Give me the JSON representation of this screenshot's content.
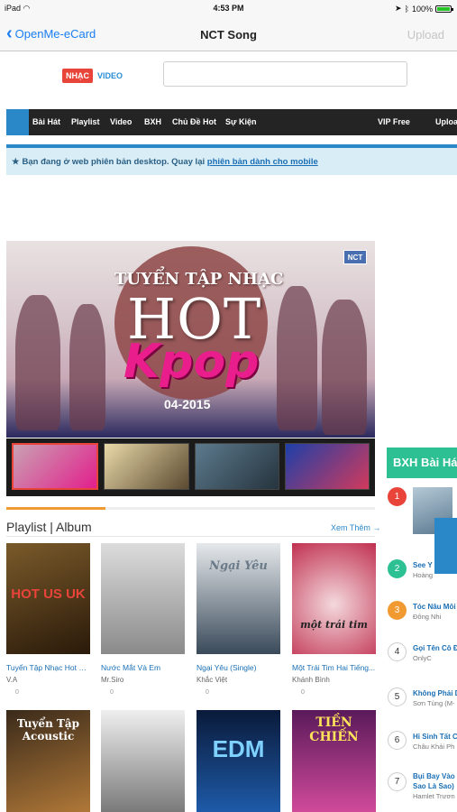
{
  "status": {
    "device": "iPad",
    "time": "4:53 PM",
    "battery": "100%"
  },
  "nav": {
    "back": "OpenMe-eCard",
    "title": "NCT Song",
    "upload": "Upload"
  },
  "header": {
    "mode_music": "NHẠC",
    "mode_video": "VIDEO",
    "search_placeholder": ""
  },
  "menu": [
    "Bài Hát",
    "Playlist",
    "Video",
    "BXH",
    "Chủ Đề Hot",
    "Sự Kiện",
    "VIP Free",
    "Uploa"
  ],
  "notice": {
    "text": "Bạn đang ở web phiên bản desktop. Quay lại ",
    "link": "phiên bản dành cho mobile"
  },
  "banner": {
    "line1": "TUYỂN TẬP NHẠC",
    "line2": "HOT",
    "line3": "Kpop",
    "line4": "04-2015",
    "logo": "NCT"
  },
  "playlist": {
    "heading": "Playlist | Album",
    "more": "Xem Thêm →",
    "items": [
      {
        "title": "Tuyển Tập Nhạc Hot U...",
        "artist": "V.A",
        "count": "0",
        "cover_text": "HOT US UK"
      },
      {
        "title": "Nước Mắt Và Em",
        "artist": "Mr.Siro",
        "count": "0",
        "cover_text": ""
      },
      {
        "title": "Ngại Yêu (Single)",
        "artist": "Khắc Việt",
        "count": "0",
        "cover_text": "Ngại Yêu"
      },
      {
        "title": "Một Trái Tim Hai Tiếng...",
        "artist": "Khánh Bình",
        "count": "0",
        "cover_text": "một trái tim"
      },
      {
        "title": "",
        "artist": "",
        "count": "",
        "cover_text": "Tuyển Tập Acoustic"
      },
      {
        "title": "",
        "artist": "",
        "count": "",
        "cover_text": ""
      },
      {
        "title": "",
        "artist": "",
        "count": "",
        "cover_text": "EDM"
      },
      {
        "title": "",
        "artist": "",
        "count": "",
        "cover_text": "TIỀN CHIẾN"
      }
    ]
  },
  "bxh": {
    "heading": "BXH Bài Hát",
    "rows": [
      {
        "rank": "1",
        "song": "",
        "singer": ""
      },
      {
        "rank": "2",
        "song": "See Y",
        "singer": "Hoàng"
      },
      {
        "rank": "3",
        "song": "Tóc Nâu Môi",
        "singer": "Đông Nhi"
      },
      {
        "rank": "4",
        "song": "Gọi Tên Cô Đ",
        "singer": "OnlyC"
      },
      {
        "rank": "5",
        "song": "Không Phải D",
        "singer": "Sơn Tùng (M-"
      },
      {
        "rank": "6",
        "song": "Hi Sinh Tất C",
        "singer": "Châu Khải Ph"
      },
      {
        "rank": "7",
        "song": "Bụi Bay Vào M",
        "song2": "Sao Là Sao)",
        "singer": "Hamlet Trươn"
      }
    ]
  },
  "colors": {
    "accent": "#2a87c8",
    "red": "#e8443a",
    "green": "#2cc092",
    "orange": "#f19a32"
  }
}
